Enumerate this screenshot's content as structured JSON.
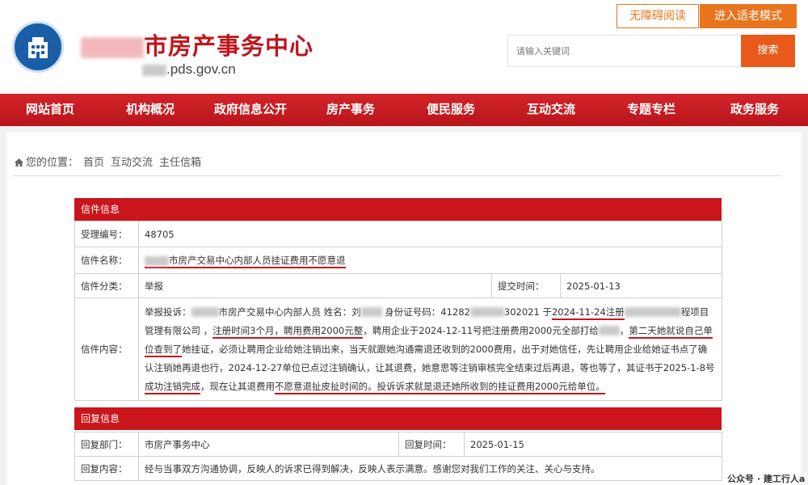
{
  "header": {
    "site_name": "市房产事务中心",
    "site_domain": ".pds.gov.cn",
    "accessibility_label": "无障碍阅读",
    "elder_mode_label": "进入适老模式",
    "search_placeholder": "请输入关键词",
    "search_button": "搜索"
  },
  "colors": {
    "brand_red": "#c9151b",
    "accent_orange": "#e8751e",
    "logo_blue": "#1a5ea8"
  },
  "nav": {
    "items": [
      {
        "label": "网站首页"
      },
      {
        "label": "机构概况"
      },
      {
        "label": "政府信息公开"
      },
      {
        "label": "房产事务"
      },
      {
        "label": "便民服务"
      },
      {
        "label": "互动交流"
      },
      {
        "label": "专题专栏"
      },
      {
        "label": "政务服务"
      }
    ]
  },
  "breadcrumb": {
    "prefix": "您的位置：",
    "items": [
      "首页",
      "互动交流",
      "主任信箱"
    ]
  },
  "letter": {
    "section_title": "信件信息",
    "id_label": "受理编号：",
    "id_value": "48705",
    "name_label": "信件名称：",
    "name_value": "市房产交易中心内部人员挂证费用不愿意退",
    "category_label": "信件分类：",
    "category_value": "举报",
    "submit_time_label": "提交时间：",
    "submit_time_value": "2025-01-13",
    "content_label": "信件内容：",
    "content_segments": {
      "s1": "举报投诉：",
      "s2": "市房产交易中心内部人员 姓名：刘",
      "s3": " 身份证号码：41282",
      "s4": "302021 于",
      "s5": "2024-11-24注册",
      "s6": "程项目管理有限公司 ，",
      "s7": "注册时间3个月，聘用费用2000元整",
      "s8": "，聘用企业于2024-12-11号把注册费用2000元全部打给",
      "s9": "，",
      "s10": "第二天她就说自己单位查到了",
      "s11": "她挂证，必须让聘用企业给她注销出来，当天就跟她沟通需退还收到的2000费用，出于对她信任，先让聘用企业给她证书点了确认注销她再退也行，2024-12-27单位已点过注销确认，让其退费，她意思等注销审核完全结束过后再退，等也等了，其证书于2025-1-8号",
      "s12": "成功注销完成",
      "s13": "，现在让其退费用",
      "s14": "不愿意退扯皮扯时间的。投诉诉求就是退还她所收到的挂证费用2000元给单位。"
    }
  },
  "reply": {
    "section_title": "回复信息",
    "dept_label": "回复部门：",
    "dept_value": "市房产事务中心",
    "time_label": "回复时间：",
    "time_value": "2025-01-15",
    "content_label": "回复内容：",
    "content_value": "经与当事双方沟通协调，反映人的诉求已得到解决，反映人表示满意。感谢您对我们工作的关注、关心与支持。"
  },
  "watermark": "公众号 · 建工行人a"
}
